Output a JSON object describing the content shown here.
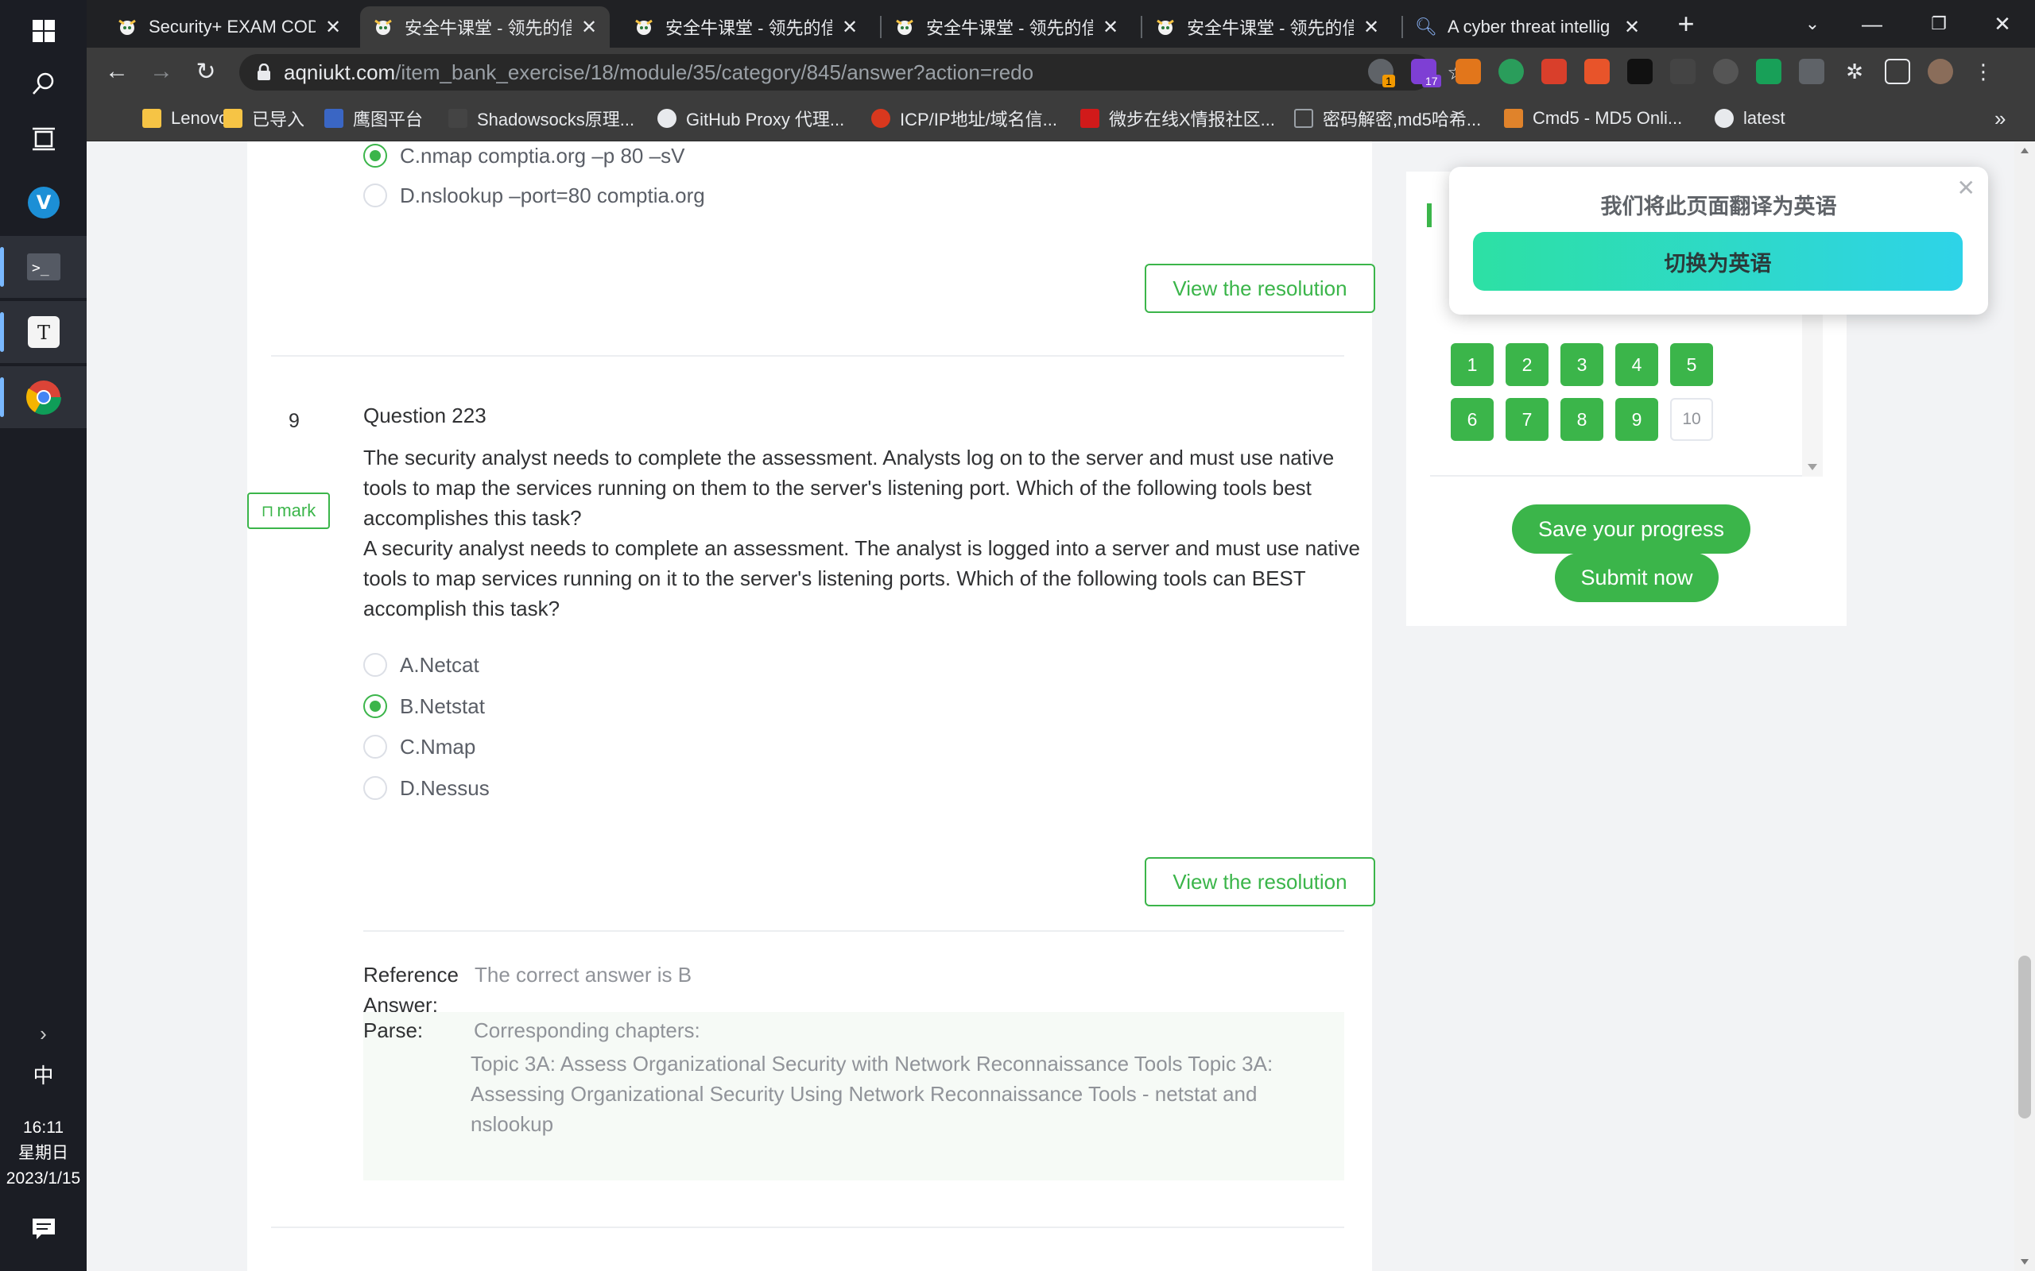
{
  "taskbar": {
    "time": "16:11",
    "weekday": "星期日",
    "date": "2023/1/15",
    "ime": "中"
  },
  "tabs": [
    {
      "title": "Security+ EXAM COD",
      "active": false
    },
    {
      "title": "安全牛课堂 - 领先的信",
      "active": true
    },
    {
      "title": "安全牛课堂 - 领先的信",
      "active": false
    },
    {
      "title": "安全牛课堂 - 领先的信",
      "active": false
    },
    {
      "title": "安全牛课堂 - 领先的信",
      "active": false
    },
    {
      "title": "A cyber threat intellig",
      "active": false
    }
  ],
  "new_tab_label": "+",
  "address": {
    "domain": "aqniukt.com",
    "path": "/item_bank_exercise/18/module/35/category/845/answer?action=redo"
  },
  "extensions": {
    "badge_1": "1",
    "badge_17": "17"
  },
  "bookmarks": [
    {
      "label": "Lenovo",
      "color": "#f6c445"
    },
    {
      "label": "已导入",
      "color": "#f6c445"
    },
    {
      "label": "鹰图平台",
      "color": "#3a66c4"
    },
    {
      "label": "Shadowsocks原理...",
      "color": "#444"
    },
    {
      "label": "GitHub Proxy 代理...",
      "color": "#e8eaed"
    },
    {
      "label": "ICP/IP地址/域名信...",
      "color": "#d9381e"
    },
    {
      "label": "微步在线X情报社区...",
      "color": "#d11a1a"
    },
    {
      "label": "密码解密,md5哈希...",
      "color": "#777"
    },
    {
      "label": "Cmd5 - MD5 Onli...",
      "color": "#e0832b"
    },
    {
      "label": "latest",
      "color": "#e8eaed"
    }
  ],
  "bookmarks_more": "»",
  "prev_question": {
    "options": [
      {
        "label": "C.nmap comptia.org –p 80 –sV",
        "selected": true
      },
      {
        "label": "D.nslookup –port=80 comptia.org",
        "selected": false
      }
    ],
    "resolution_label": "View the resolution"
  },
  "question": {
    "index": "9",
    "mark_label": "mark",
    "title": "Question 223",
    "text_1": "The security analyst needs to complete the assessment. Analysts log on to the server and must use native tools to map the services running on them to the server's listening port. Which of the following tools best accomplishes this task?",
    "text_2": "A security analyst needs to complete an assessment. The analyst is logged into a server and must use native tools to map services running on it to the server's listening ports. Which of the following tools can BEST accomplish this task?",
    "options": [
      {
        "label": "A.Netcat",
        "selected": false
      },
      {
        "label": "B.Netstat",
        "selected": true
      },
      {
        "label": "C.Nmap",
        "selected": false
      },
      {
        "label": "D.Nessus",
        "selected": false
      }
    ],
    "resolution_label": "View the resolution",
    "reference_label_1": "Reference",
    "reference_label_2": "Answer:",
    "reference_value": "The correct answer is B",
    "parse_label": "Parse:",
    "parse_heading": "Corresponding chapters:",
    "parse_body": "Topic 3A: Assess Organizational Security with Network Reconnaissance Tools Topic 3A: Assessing Organizational Security Using Network Reconnaissance Tools - netstat and nslookup"
  },
  "answer_card": {
    "numbers": [
      {
        "n": "1",
        "answered": true
      },
      {
        "n": "2",
        "answered": true
      },
      {
        "n": "3",
        "answered": true
      },
      {
        "n": "4",
        "answered": true
      },
      {
        "n": "5",
        "answered": true
      },
      {
        "n": "6",
        "answered": true
      },
      {
        "n": "7",
        "answered": true
      },
      {
        "n": "8",
        "answered": true
      },
      {
        "n": "9",
        "answered": true
      },
      {
        "n": "10",
        "answered": false
      }
    ],
    "save_label": "Save your progress",
    "submit_label": "Submit now"
  },
  "translate_popup": {
    "message": "我们将此页面翻译为英语",
    "button": "切换为英语"
  },
  "colors": {
    "accent_green": "#3bb54a",
    "translate_gradient_start": "#2de0a4",
    "translate_gradient_end": "#2ed3e8"
  }
}
